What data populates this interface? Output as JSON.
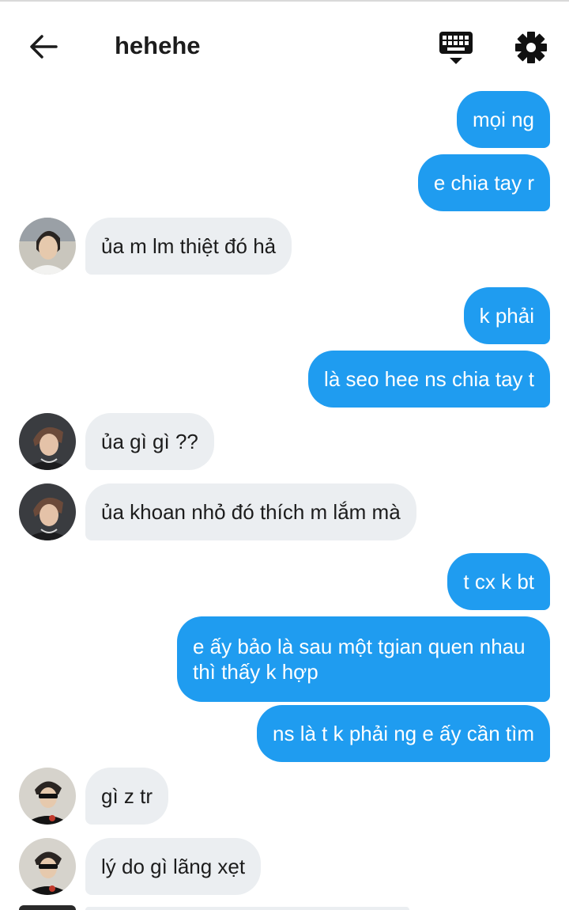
{
  "header": {
    "back_icon": "arrow-left-icon",
    "title": "hehehe",
    "keyboard_icon": "keyboard-icon",
    "settings_icon": "gear-icon"
  },
  "colors": {
    "outgoing_bubble": "#1f9cf0",
    "incoming_bubble": "#ebeef1",
    "text": "#1c1c1c"
  },
  "messages": [
    {
      "side": "out",
      "text": "mọi ng"
    },
    {
      "side": "out",
      "text": "e chia tay r"
    },
    {
      "side": "in",
      "text": "ủa m lm thiệt đó hả"
    },
    {
      "side": "out",
      "text": "k phải"
    },
    {
      "side": "out",
      "text": "là seo hee ns chia tay t"
    },
    {
      "side": "in",
      "text": "ủa gì gì ??"
    },
    {
      "side": "in",
      "text": "ủa khoan nhỏ đó thích m lắm mà"
    },
    {
      "side": "out",
      "text": "t cx k bt"
    },
    {
      "side": "out",
      "text": "e ấy bảo là sau một tgian quen nhau thì thấy k hợp"
    },
    {
      "side": "out",
      "text": "ns là t k phải ng e ấy cần tìm"
    },
    {
      "side": "in",
      "text": "gì z tr"
    },
    {
      "side": "in",
      "text": "lý do gì lãng xẹt"
    }
  ]
}
